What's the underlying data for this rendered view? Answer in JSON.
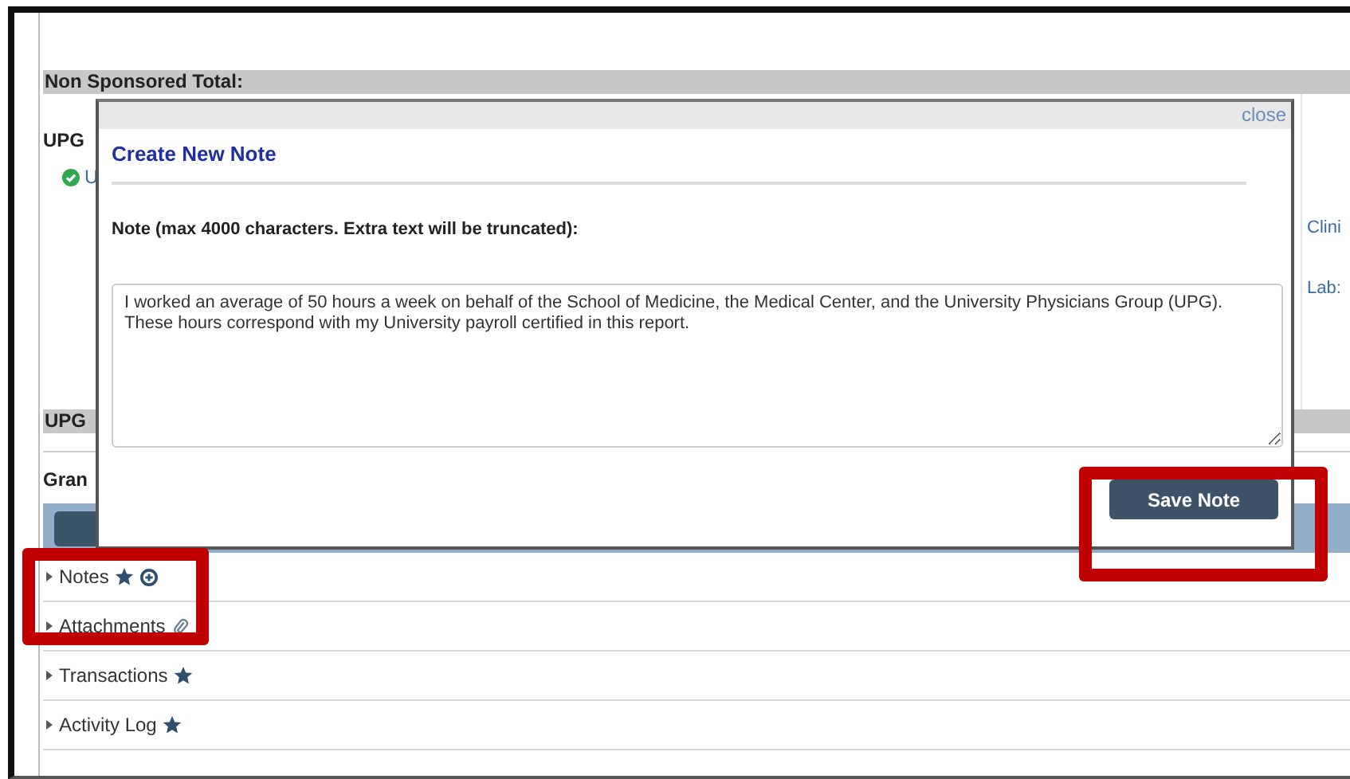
{
  "page": {
    "section_header": "Non Sponsored Total:",
    "upg_label": "UPG",
    "upg_link": "U",
    "right_links": [
      "Clini",
      "Lab:"
    ],
    "upg_header": "UPG",
    "grand_label": "Gran",
    "panels": [
      {
        "label": "Notes",
        "expanded": false,
        "kind": "addable"
      },
      {
        "label": "Attachments",
        "expanded": false,
        "kind": "attachments"
      },
      {
        "label": "Transactions",
        "expanded": false,
        "kind": "starred"
      },
      {
        "label": "Activity Log",
        "expanded": false,
        "kind": "starred"
      }
    ]
  },
  "dialog": {
    "close": "close",
    "title": "Create New Note",
    "field_label": "Note (max 4000 characters. Extra text will be truncated):",
    "note_text": "I worked an average of 50 hours a week on behalf of the School of Medicine, the Medical Center, and the University Physicians Group (UPG). These hours correspond with my University payroll certified in this report.",
    "button": "Save Note"
  }
}
